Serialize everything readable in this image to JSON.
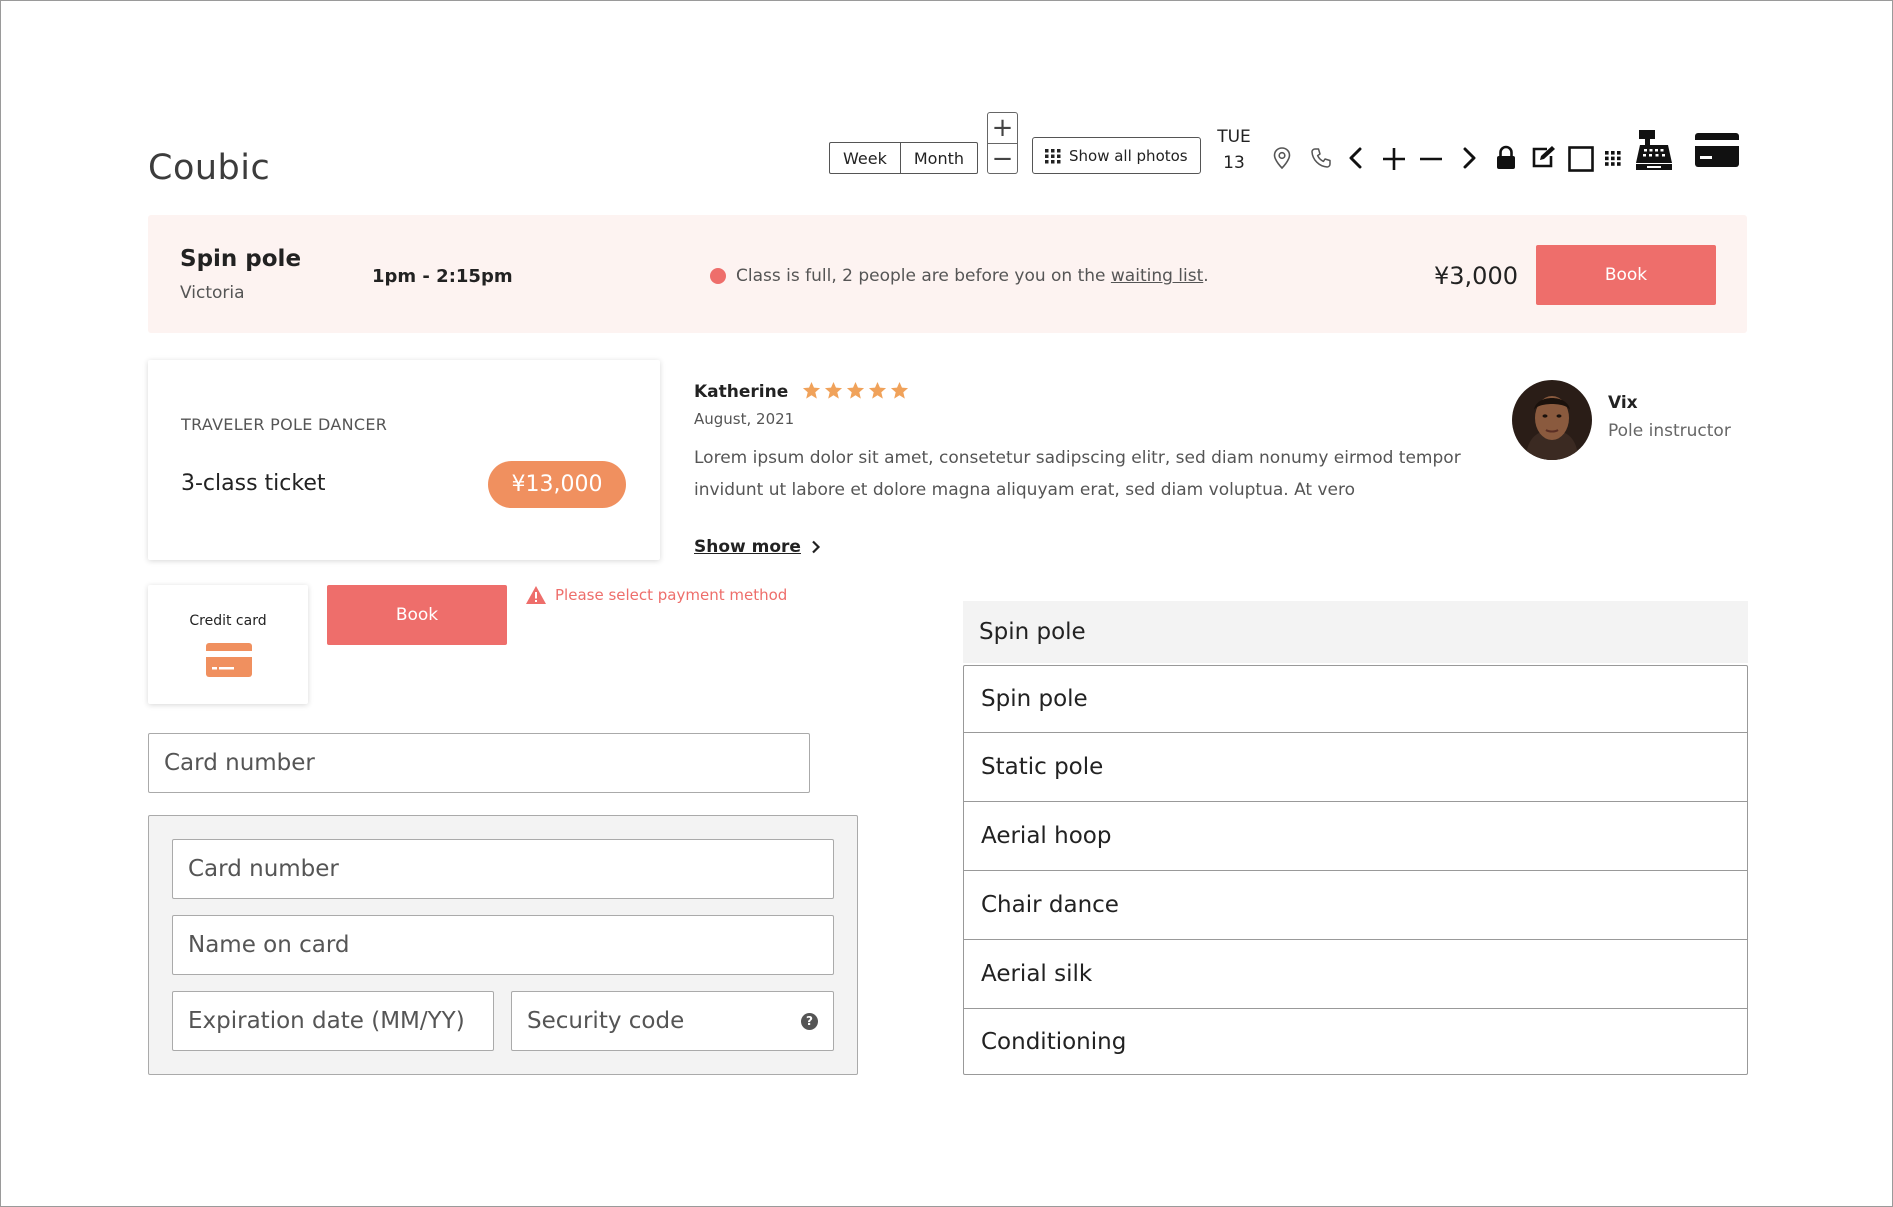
{
  "brand": {
    "logo": "Coubic"
  },
  "toolbar": {
    "view_week": "Week",
    "view_month": "Month",
    "zoom_in": "+",
    "zoom_out": "−",
    "show_photos": "Show all photos",
    "date_day": "TUE",
    "date_num": "13"
  },
  "banner": {
    "title": "Spin pole",
    "location": "Victoria",
    "time": "1pm - 2:15pm",
    "status_prefix": "Class is full, 2 people are before you on the ",
    "status_link": "waiting list",
    "status_suffix": ".",
    "price": "¥3,000",
    "book_label": "Book"
  },
  "ticket": {
    "kicker": "TRAVELER POLE DANCER",
    "name": "3-class ticket",
    "price": "¥13,000"
  },
  "review": {
    "author": "Katherine",
    "stars": 5,
    "date": "August, 2021",
    "body": "Lorem ipsum dolor sit amet, consetetur sadipscing elitr, sed diam nonumy eirmod tempor invidunt ut labore et dolore magna aliquyam erat, sed diam voluptua. At vero",
    "show_more": "Show more"
  },
  "instructor": {
    "name": "Vix",
    "role": "Pole instructor"
  },
  "payment": {
    "method_label": "Credit card",
    "book_label": "Book",
    "error": "Please select payment method",
    "card_number_placeholder": "Card number",
    "form": {
      "card_number_placeholder": "Card number",
      "name_placeholder": "Name on card",
      "expiry_placeholder": "Expiration date (MM/YY)",
      "security_placeholder": "Security code"
    }
  },
  "class_select": {
    "selected": "Spin pole",
    "options": [
      "Spin pole",
      "Static pole",
      "Aerial hoop",
      "Chair dance",
      "Aerial silk",
      "Conditioning"
    ]
  },
  "colors": {
    "accent": "#ee6e6b",
    "orange": "#f0905f",
    "banner_bg": "#fdf3f1",
    "star": "#f0a25a"
  }
}
